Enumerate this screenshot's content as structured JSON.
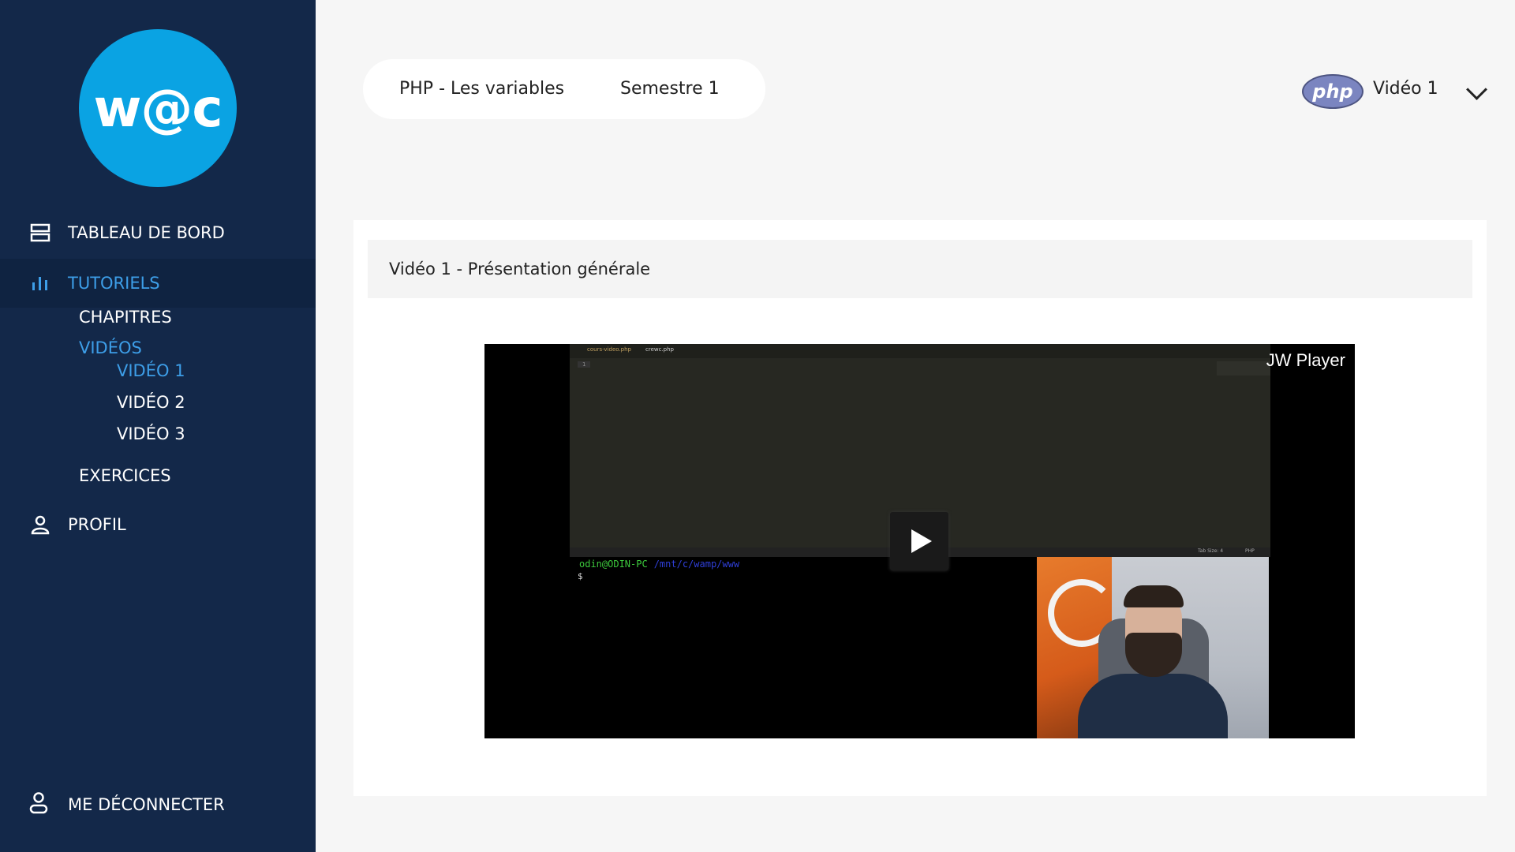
{
  "logo": {
    "text": "w@c"
  },
  "sidebar": {
    "dashboard": "TABLEAU DE BORD",
    "tutorials": "TUTORIELS",
    "chapters": "CHAPITRES",
    "videos": "VIDÉOS",
    "video_items": [
      "VIDÉO 1",
      "VIDÉO 2",
      "VIDÉO 3"
    ],
    "exercises": "EXERCICES",
    "profile": "PROFIL",
    "logout": "ME DÉCONNECTER"
  },
  "header": {
    "course": "PHP - Les variables",
    "semester": "Semestre 1",
    "badge": "php",
    "video_select": "Vidéo 1"
  },
  "main": {
    "title": "Vidéo 1 - Présentation générale"
  },
  "player": {
    "brand": "JW Player",
    "tab1": "cours-video.php",
    "tab2": "crewc.php",
    "line_number": "1",
    "status_left": "Tab Size: 4",
    "status_right": "PHP",
    "terminal_user": "odin@ODIN-PC",
    "terminal_path": "/mnt/c/wamp/www",
    "terminal_prompt": "$"
  },
  "colors": {
    "sidebar_bg": "#132849",
    "accent": "#3d9ee8",
    "logo_bg": "#0aa3e3"
  }
}
